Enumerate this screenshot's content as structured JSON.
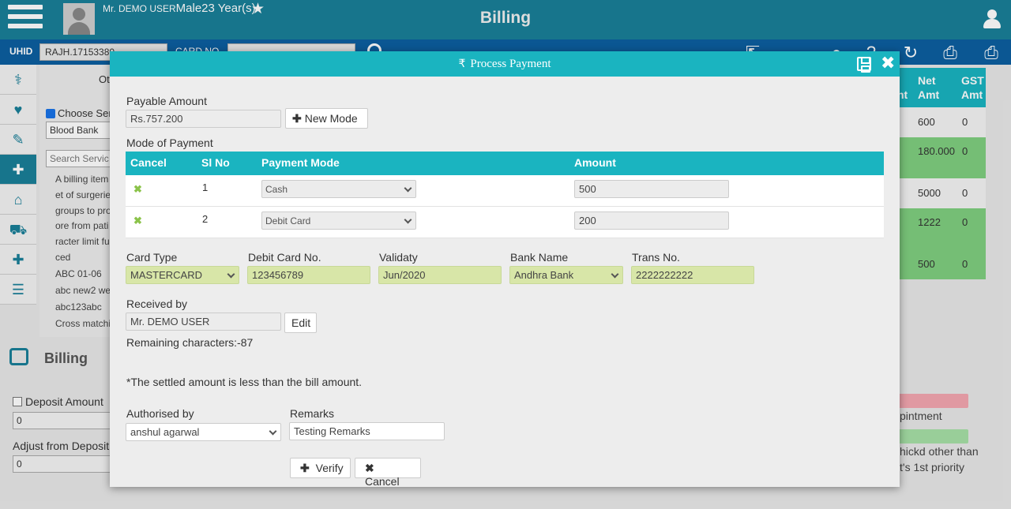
{
  "header": {
    "patient_name": "Mr. DEMO USER",
    "patient_gender_age": "Male23 Year(s)",
    "title": "Billing"
  },
  "subbar": {
    "uhid_label": "UHID",
    "uhid_value": "RAJH.17153380",
    "card_label": "CARD NO"
  },
  "background": {
    "ot_label": "Ot",
    "choose_service": "Choose Ser",
    "blood_bank": "Blood Bank",
    "search_placeholder": "Search Servic",
    "list_lines": [
      "A billing item",
      "et of surgerie",
      "groups to pro",
      "ore from pati",
      "racter limit fu",
      "ced",
      "ABC 01-06",
      "abc new2 we",
      "abc123abc",
      "Cross matchi"
    ],
    "billing_title": "Billing",
    "deposit_amount": "Deposit Amount",
    "deposit_value": "0",
    "adjust_from_deposit": "Adjust from Deposit",
    "adjust_value": "0",
    "right_table_head": [
      "Net",
      "Amt",
      "GST",
      "Amt",
      "nt"
    ],
    "right_rows": [
      {
        "net": "600",
        "gst": "0"
      },
      {
        "net": "180.000",
        "gst": "0"
      },
      {
        "net": "5000",
        "gst": "0"
      },
      {
        "net": "1222",
        "gst": "0"
      },
      {
        "net": "500",
        "gst": "0"
      }
    ],
    "right_notes": [
      "pintment",
      "hickd other than",
      "t's 1st priority"
    ]
  },
  "modal": {
    "title": "Process Payment",
    "payable_amount_label": "Payable Amount",
    "payable_amount_value": "Rs.757.200",
    "new_mode_label": "New Mode",
    "mode_of_payment_label": "Mode of Payment",
    "table_headers": [
      "Cancel",
      "Sl No",
      "Payment Mode",
      "Amount"
    ],
    "payments": [
      {
        "sl": "1",
        "mode": "Cash",
        "amount": "500"
      },
      {
        "sl": "2",
        "mode": "Debit Card",
        "amount": "200"
      }
    ],
    "card_type_label": "Card Type",
    "card_type_value": "MASTERCARD",
    "debit_card_no_label": "Debit Card No.",
    "debit_card_no_value": "123456789",
    "validity_label": "Validaty",
    "validity_value": "Jun/2020",
    "bank_name_label": "Bank Name",
    "bank_name_value": "Andhra Bank",
    "trans_no_label": "Trans No.",
    "trans_no_value": "2222222222",
    "received_by_label": "Received by",
    "received_by_value": "Mr. DEMO USER",
    "edit_label": "Edit",
    "remaining_chars": "Remaining characters:-87",
    "settled_note": "*The settled amount is less than the bill amount.",
    "authorised_by_label": "Authorised by",
    "authorised_by_value": "anshul agarwal",
    "remarks_label": "Remarks",
    "remarks_value": "Testing Remarks",
    "verify_label": "Verify",
    "cancel_label": "Cancel"
  },
  "colors": {
    "header_teal": "#1a7f98",
    "subbar_blue": "#0d5fa0",
    "modal_teal": "#1ab4c0",
    "field_green": "#d8e6a8",
    "row_green": "#7fcf7f"
  }
}
